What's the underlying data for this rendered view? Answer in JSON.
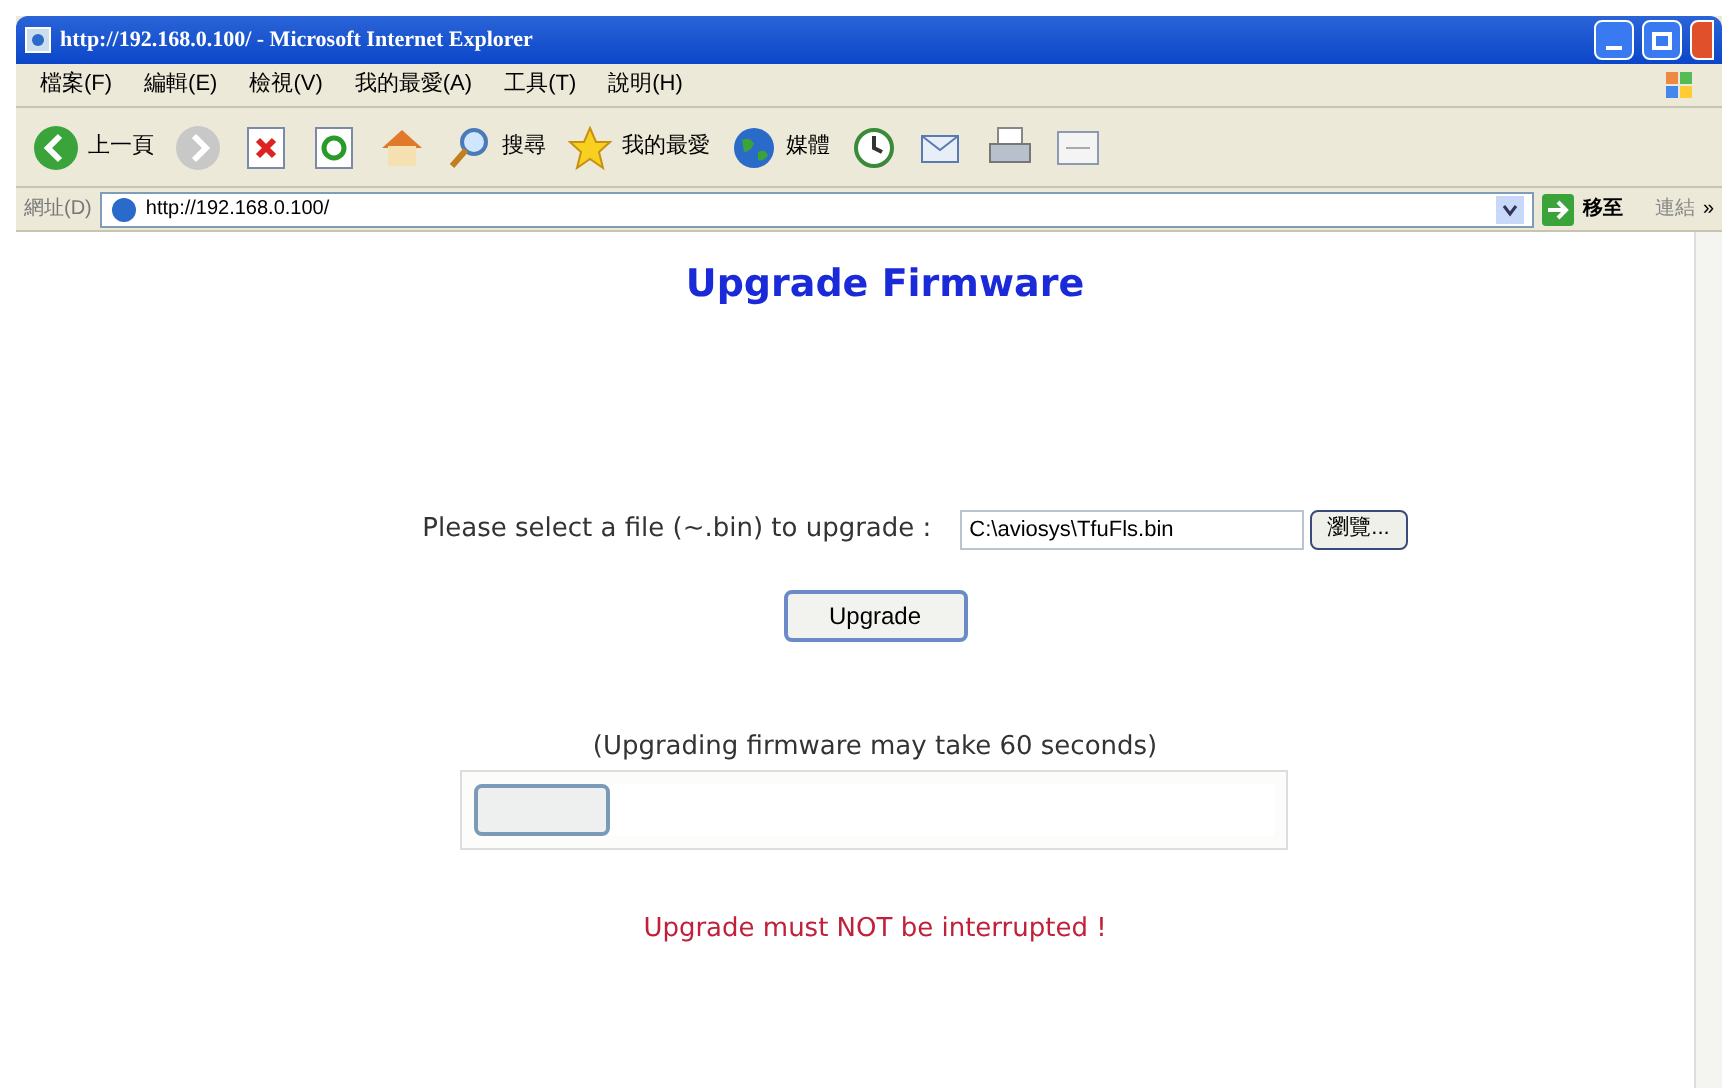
{
  "window": {
    "title": "http://192.168.0.100/ - Microsoft Internet Explorer"
  },
  "menu": [
    "檔案(F)",
    "編輯(E)",
    "檢視(V)",
    "我的最愛(A)",
    "工具(T)",
    "說明(H)"
  ],
  "toolbar": [
    {
      "kind": "back",
      "label": "上一頁"
    },
    {
      "kind": "forward"
    },
    {
      "kind": "stop"
    },
    {
      "kind": "refresh"
    },
    {
      "kind": "home"
    },
    {
      "kind": "search",
      "label": "搜尋"
    },
    {
      "kind": "favorites",
      "label": "我的最愛"
    },
    {
      "kind": "media",
      "label": "媒體"
    },
    {
      "kind": "history"
    },
    {
      "kind": "mail"
    },
    {
      "kind": "print"
    },
    {
      "kind": "edit"
    }
  ],
  "address_bar": {
    "label": "網址(D)",
    "value": "http://192.168.0.100/",
    "go": "移至",
    "links": "連結",
    "more": "»"
  },
  "page": {
    "heading": "Upgrade Firmware",
    "file_label": "Please select a file (~.bin) to upgrade :",
    "file_value": "C:\\aviosys\\TfuFls.bin",
    "browse": "瀏覽...",
    "upgrade": "Upgrade",
    "note": "(Upgrading firmware may take 60 seconds)",
    "progress": {
      "level": 0.17
    },
    "warning": "Upgrade must NOT be interrupted !"
  }
}
